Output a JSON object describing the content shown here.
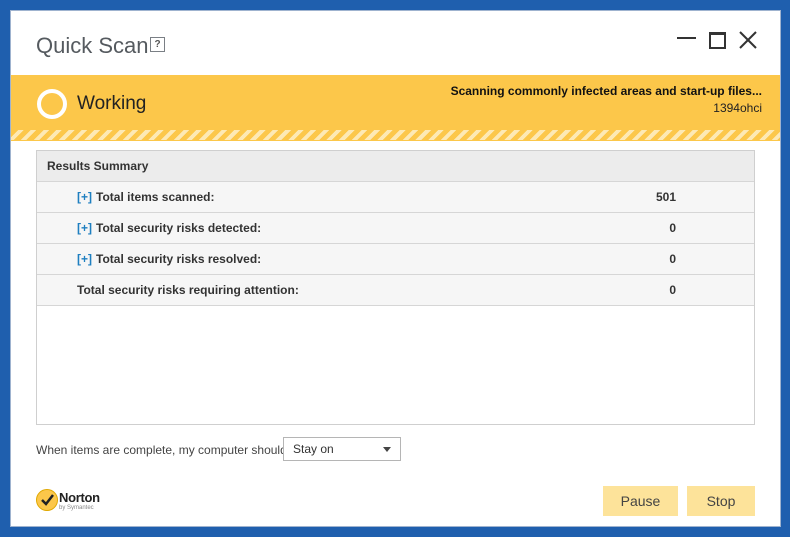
{
  "window": {
    "title": "Quick Scan",
    "help_label": "?"
  },
  "status": {
    "label": "Working",
    "message": "Scanning commonly infected areas and start-up files...",
    "current_file": "1394ohci"
  },
  "results": {
    "header": "Results Summary",
    "expand_label": "[+]",
    "rows": [
      {
        "label": "Total items scanned:",
        "value": "501",
        "expandable": true
      },
      {
        "label": "Total security risks detected:",
        "value": "0",
        "expandable": true
      },
      {
        "label": "Total security risks resolved:",
        "value": "0",
        "expandable": true
      },
      {
        "label": "Total security risks requiring attention:",
        "value": "0",
        "expandable": false
      }
    ]
  },
  "completion": {
    "label": "When items are complete, my computer should",
    "selected": "Stay on"
  },
  "brand": {
    "name": "Norton",
    "sub": "by Symantec"
  },
  "buttons": {
    "pause": "Pause",
    "stop": "Stop"
  },
  "colors": {
    "accent": "#fcc74a",
    "button": "#fde39a",
    "link": "#1e7fc0",
    "desktop": "#1f5fae"
  }
}
